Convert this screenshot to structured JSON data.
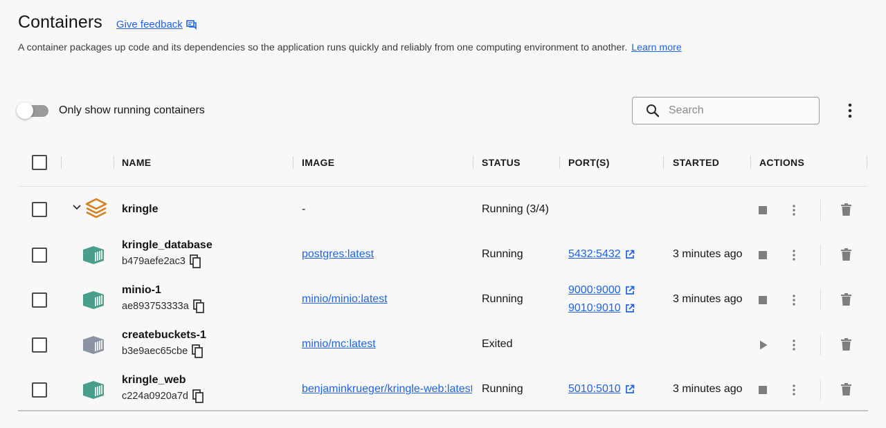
{
  "header": {
    "title": "Containers",
    "feedback_label": "Give feedback",
    "description": "A container packages up code and its dependencies so the application runs quickly and reliably from one computing environment to another.",
    "learn_more": "Learn more"
  },
  "toolbar": {
    "toggle_label": "Only show running containers",
    "toggle_on": false,
    "search_placeholder": "Search"
  },
  "table": {
    "columns": [
      "NAME",
      "IMAGE",
      "STATUS",
      "PORT(S)",
      "STARTED",
      "ACTIONS"
    ],
    "group": {
      "name": "kringle",
      "image": "-",
      "status": "Running (3/4)"
    },
    "rows": [
      {
        "name": "kringle_database",
        "id": "b479aefe2ac3",
        "image": "postgres:latest",
        "status": "Running",
        "ports": [
          "5432:5432"
        ],
        "started": "3 minutes ago"
      },
      {
        "name": "minio-1",
        "id": "ae893753333a",
        "image": "minio/minio:latest",
        "status": "Running",
        "ports": [
          "9000:9000",
          "9010:9010"
        ],
        "started": "3 minutes ago"
      },
      {
        "name": "createbuckets-1",
        "id": "b3e9aec65cbe",
        "image": "minio/mc:latest",
        "status": "Exited",
        "ports": [],
        "started": ""
      },
      {
        "name": "kringle_web",
        "id": "c224a0920a7d",
        "image": "benjaminkrueger/kringle-web:latest",
        "status": "Running",
        "ports": [
          "5010:5010"
        ],
        "started": "3 minutes ago"
      }
    ]
  },
  "colors": {
    "link": "#1d63ed",
    "running_icon": "#4a9e8c",
    "exited_icon": "#8a94a3",
    "group_icon": "#d6801a"
  },
  "icons": [
    "feedback-icon",
    "search-icon",
    "more-vert-icon",
    "chevron-down-icon",
    "stack-icon",
    "container-icon",
    "copy-icon",
    "external-link-icon",
    "stop-icon",
    "play-icon",
    "trash-icon"
  ]
}
